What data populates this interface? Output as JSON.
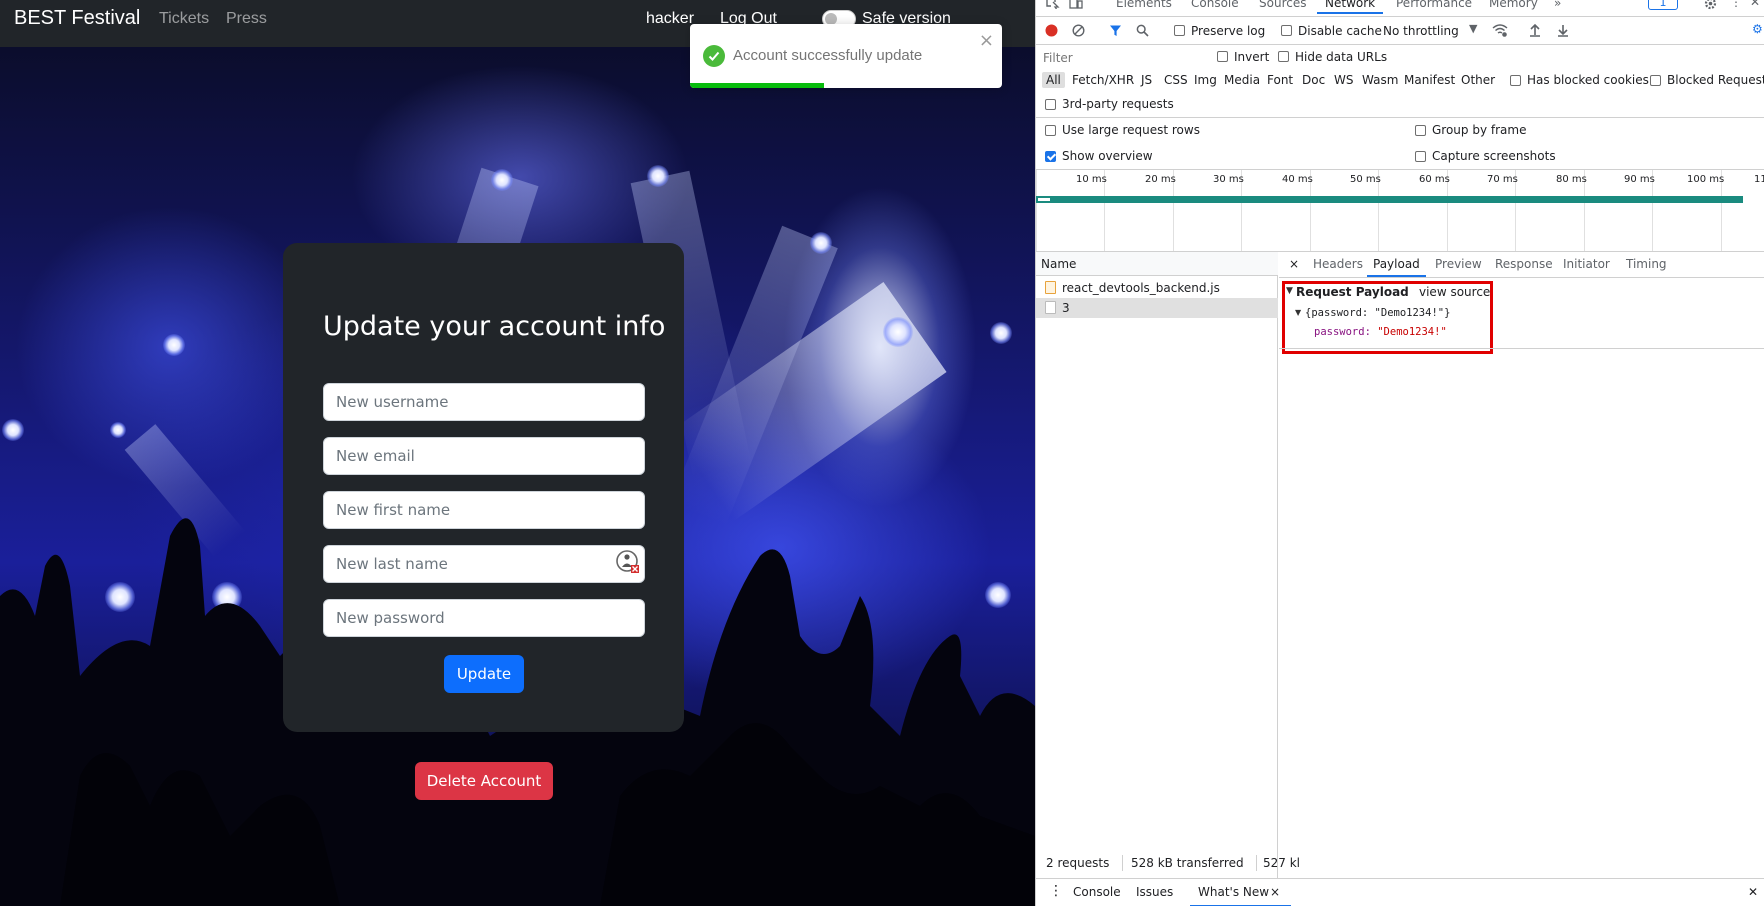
{
  "site": {
    "brand": "BEST Festival",
    "nav": [
      {
        "label": "Tickets"
      },
      {
        "label": "Press"
      }
    ],
    "user": "hacker",
    "logout": "Log Out",
    "toggle_label": "Safe version",
    "form": {
      "title": "Update your account info",
      "fields": [
        {
          "placeholder": "New username"
        },
        {
          "placeholder": "New email"
        },
        {
          "placeholder": "New first name"
        },
        {
          "placeholder": "New last name"
        },
        {
          "placeholder": "New password"
        }
      ],
      "submit": "Update"
    },
    "delete_button": "Delete Account",
    "toast": {
      "message": "Account successfully update",
      "close": "×",
      "progress": 0.43,
      "color": "#07bc0c"
    },
    "colors": {
      "primary": "#0d6efd",
      "danger": "#dc3545",
      "card": "#212529"
    }
  },
  "devtools": {
    "panels": [
      {
        "label": "Elements"
      },
      {
        "label": "Console"
      },
      {
        "label": "Sources"
      },
      {
        "label": "Network",
        "active": true
      },
      {
        "label": "Performance"
      },
      {
        "label": "Memory"
      }
    ],
    "issues_badge": "1",
    "toolbar": {
      "preserve_log": "Preserve log",
      "disable_cache": "Disable cache",
      "throttling": "No throttling"
    },
    "filter": {
      "placeholder": "Filter",
      "invert": "Invert",
      "hide_data_urls": "Hide data URLs"
    },
    "types": [
      "All",
      "Fetch/XHR",
      "JS",
      "CSS",
      "Img",
      "Media",
      "Font",
      "Doc",
      "WS",
      "Wasm",
      "Manifest",
      "Other"
    ],
    "has_blocked_cookies": "Has blocked cookies",
    "blocked_requests": "Blocked Requests",
    "third_party": "3rd-party requests",
    "options": {
      "large_rows": "Use large request rows",
      "group_by_frame": "Group by frame",
      "show_overview": "Show overview",
      "capture_screenshots": "Capture screenshots"
    },
    "timeline_ticks": [
      "10 ms",
      "20 ms",
      "30 ms",
      "40 ms",
      "50 ms",
      "60 ms",
      "70 ms",
      "80 ms",
      "90 ms",
      "100 ms",
      "11"
    ],
    "name_header": "Name",
    "requests": [
      {
        "name": "react_devtools_backend.js",
        "type": "js"
      },
      {
        "name": "3",
        "type": "doc",
        "selected": true
      }
    ],
    "detail_tabs": [
      {
        "label": "Headers"
      },
      {
        "label": "Payload",
        "active": true
      },
      {
        "label": "Preview"
      },
      {
        "label": "Response"
      },
      {
        "label": "Initiator"
      },
      {
        "label": "Timing"
      }
    ],
    "close_glyph": "×",
    "payload": {
      "title": "Request Payload",
      "view_source": "view source",
      "object_summary_key": "{password: ",
      "object_summary_value": "\"Demo1234!\"",
      "object_summary_end": "}",
      "prop_key": "password",
      "prop_value": "\"Demo1234!\""
    },
    "status": {
      "requests": "2 requests",
      "transferred": "528 kB transferred",
      "resources": "527 kl"
    },
    "drawer": [
      {
        "label": "Console"
      },
      {
        "label": "Issues"
      },
      {
        "label": "What's New",
        "active": true
      }
    ]
  }
}
